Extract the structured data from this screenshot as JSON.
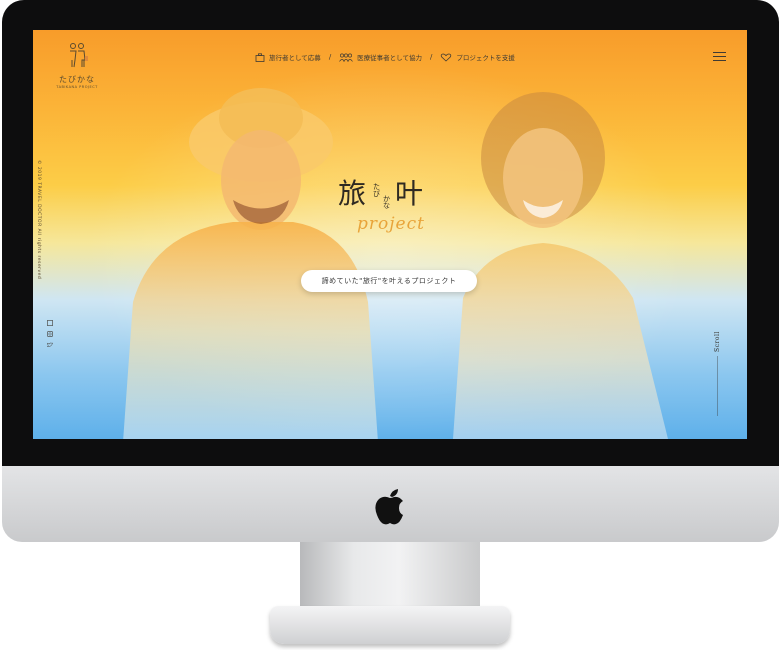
{
  "brand": {
    "logo_text": "たびかな",
    "logo_sub": "TABIKANA PROJECT"
  },
  "nav": {
    "items": [
      {
        "label": "旅行者として応募",
        "icon": "suitcase-icon"
      },
      {
        "label": "医療従事者として協力",
        "icon": "people-icon"
      },
      {
        "label": "プロジェクトを支援",
        "icon": "heart-hands-icon"
      }
    ],
    "separator": "/",
    "menu_icon": "hamburger-menu-icon"
  },
  "sidebar": {
    "copyright": "© 2019 TRAVEL DOCTOR All rights reserved",
    "social": [
      "facebook-icon",
      "instagram-icon",
      "twitter-icon"
    ]
  },
  "hero": {
    "kanji_1": "旅",
    "kanji_2": "叶",
    "ruby_1": "たび",
    "ruby_2": "かな",
    "project": "project",
    "tagline": "諦めていた\"旅行\"を叶えるプロジェクト",
    "scroll": "Scroll"
  },
  "colors": {
    "gradient_top": "#f89c2a",
    "gradient_mid": "#fccd47",
    "gradient_bottom": "#5eb0ea",
    "accent": "#e8a43a",
    "text_dark": "#2f2a22"
  }
}
